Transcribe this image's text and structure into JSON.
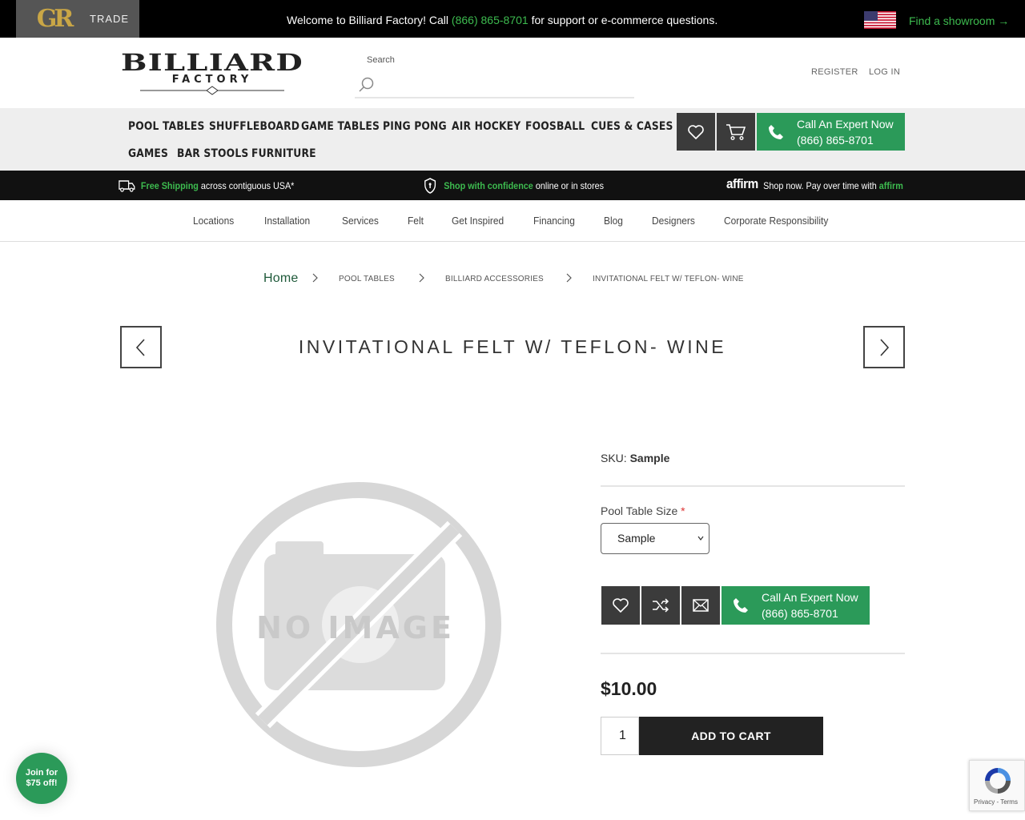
{
  "topbar": {
    "trade_logo": "GR",
    "trade_label": "TRADE",
    "welcome_prefix": "Welcome to Billiard Factory! Call",
    "welcome_phone": "(866) 865-8701",
    "welcome_suffix": "for support or e-commerce questions.",
    "showroom_link": "Find a showroom →"
  },
  "header": {
    "brand_line1": "BILLIARD",
    "brand_line2": "FACTORY",
    "search_label": "Search",
    "register": "REGISTER",
    "login": "LOG IN"
  },
  "nav": {
    "items": [
      "POOL TABLES",
      "SHUFFLEBOARD",
      "GAME TABLES",
      "PING PONG",
      "AIR HOCKEY",
      "FOOSBALL",
      "CUES & CASES",
      "GAMES",
      "BAR STOOLS",
      "FURNITURE"
    ],
    "call_line1": "Call An Expert Now",
    "call_line2": "(866) 865-8701"
  },
  "promo": {
    "shipping_bold": "Free Shipping",
    "shipping_rest": "across contiguous USA*",
    "confidence_bold": "Shop with confidence",
    "confidence_rest": "online or in stores",
    "affirm_logo": "affirm",
    "affirm_text": "Shop now. Pay over time with",
    "affirm_link": "affirm"
  },
  "subnav": [
    "Locations",
    "Installation",
    "Services",
    "Felt",
    "Get Inspired",
    "Financing",
    "Blog",
    "Designers",
    "Corporate Responsibility"
  ],
  "breadcrumb": [
    "Home",
    "POOL TABLES",
    "BILLIARD ACCESSORIES",
    "INVITATIONAL FELT W/ TEFLON- WINE"
  ],
  "product": {
    "title": "INVITATIONAL FELT W/ TEFLON- WINE",
    "no_image_text": "NO IMAGE",
    "sku_label": "SKU:",
    "sku_value": "Sample",
    "size_label": "Pool Table Size",
    "size_required": "*",
    "size_selected": "Sample",
    "call_line1": "Call An Expert Now",
    "call_line2": "(866) 865-8701",
    "price": "$10.00",
    "quantity": "1",
    "add_to_cart": "ADD TO CART"
  },
  "popup": {
    "join_line1": "Join for",
    "join_line2": "$75 off!"
  },
  "recaptcha": {
    "terms": "Privacy - Terms"
  },
  "colors": {
    "accent_green": "#2b9a59",
    "link_green": "#3dbb4f",
    "dark": "#3b3b3b"
  }
}
